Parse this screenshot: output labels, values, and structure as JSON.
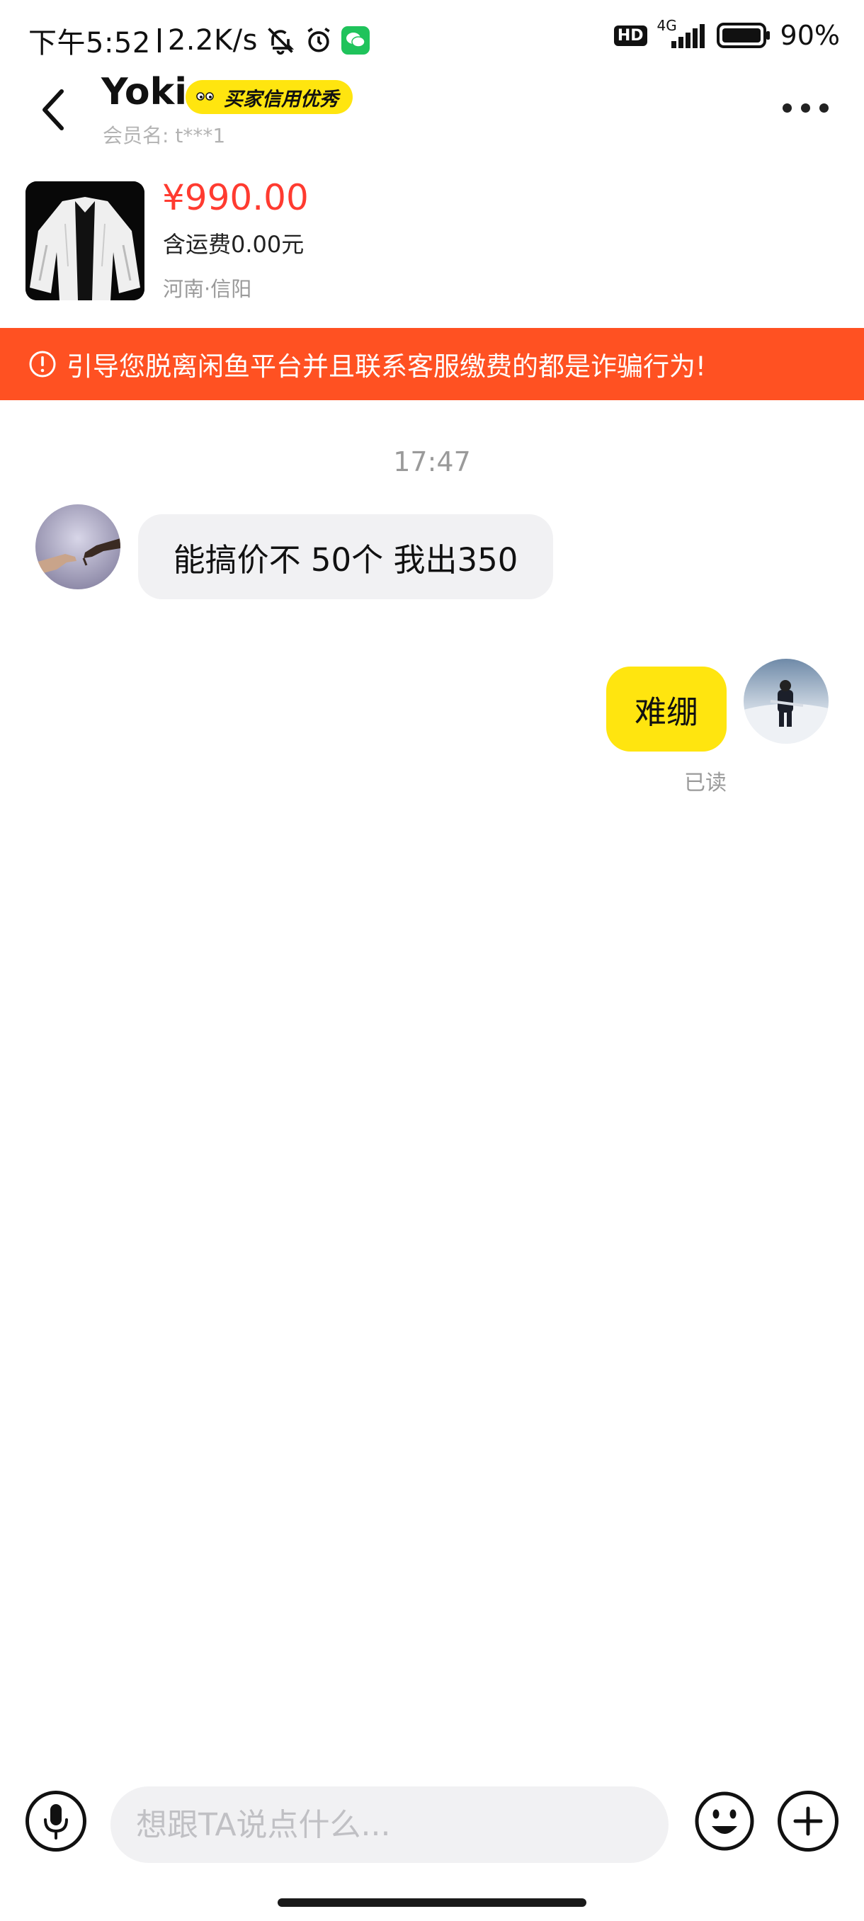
{
  "status_bar": {
    "time": "下午5:52",
    "network_speed": "2.2K/s",
    "network_type": "4G",
    "hd_label": "HD",
    "battery": "90%"
  },
  "header": {
    "user_name": "Yoki",
    "credit_badge": "买家信用优秀",
    "member_label": "会员名: t***1"
  },
  "product": {
    "price": "¥990.00",
    "shipping": "含运费0.00元",
    "location": "河南·信阳"
  },
  "warning": {
    "text": "引导您脱离闲鱼平台并且联系客服缴费的都是诈骗行为!"
  },
  "chat": {
    "timestamp": "17:47",
    "messages": [
      {
        "from": "other",
        "text": "能搞价不 50个 我出350"
      },
      {
        "from": "me",
        "text": "难绷",
        "status": "已读"
      }
    ]
  },
  "input_bar": {
    "placeholder": "想跟TA说点什么..."
  },
  "colors": {
    "accent_yellow": "#ffe50f",
    "price_red": "#ff3b30",
    "warning_orange": "#ff5122",
    "bubble_gray": "#f1f1f3",
    "wechat_green": "#1fc35b"
  },
  "icons": {
    "back": "chevron-left-icon",
    "more": "more-dots-icon",
    "voice": "microphone-icon",
    "emoji": "smiley-icon",
    "plus": "plus-icon",
    "warning": "exclamation-circle-icon"
  }
}
